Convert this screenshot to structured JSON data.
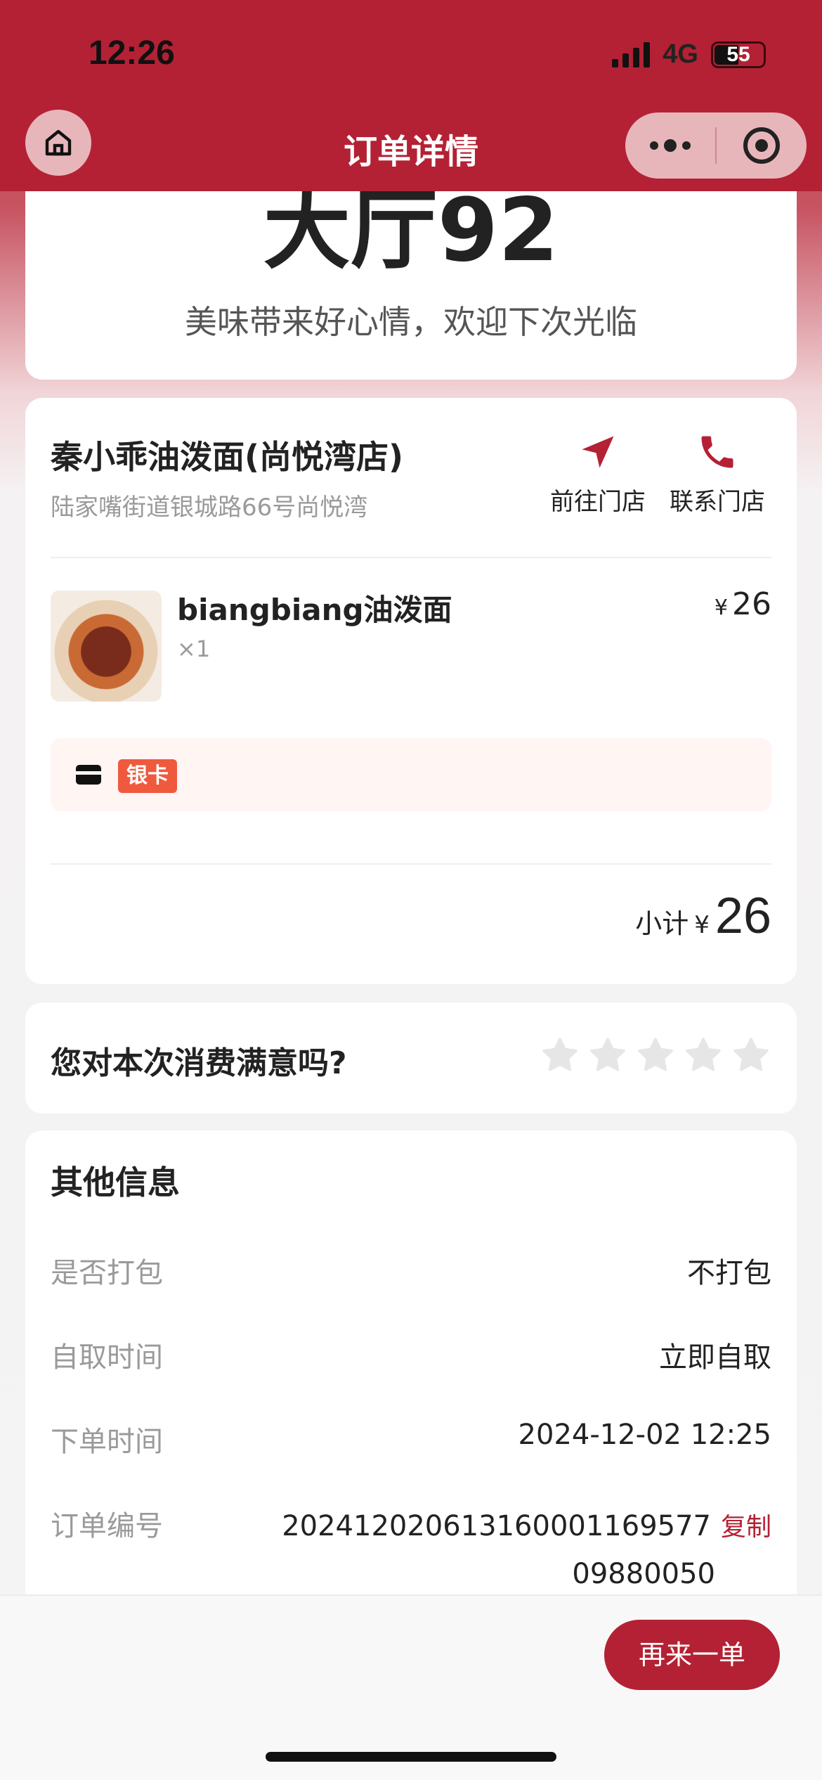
{
  "status_bar": {
    "time": "12:26",
    "network": "4G",
    "battery": "55"
  },
  "nav": {
    "title": "订单详情"
  },
  "pickup": {
    "code": "大厅92",
    "message": "美味带来好心情，欢迎下次光临"
  },
  "store": {
    "name": "秦小乖油泼面(尚悦湾店)",
    "address": "陆家嘴街道银城路66号尚悦湾",
    "go_label": "前往门店",
    "call_label": "联系门店"
  },
  "item": {
    "name": "biangbiang油泼面",
    "qty": "×1",
    "currency": "¥",
    "price": "26"
  },
  "payment": {
    "badge": "银卡"
  },
  "subtotal": {
    "label": "小计",
    "currency": "¥",
    "amount": "26"
  },
  "rating": {
    "question": "您对本次消费满意吗?",
    "max_stars": 5,
    "selected": 0
  },
  "info": {
    "title": "其他信息",
    "rows": [
      {
        "key": "是否打包",
        "value": "不打包"
      },
      {
        "key": "自取时间",
        "value": "立即自取"
      },
      {
        "key": "下单时间",
        "value": "2024-12-02 12:25"
      }
    ],
    "order_no_key": "订单编号",
    "order_no": "20241202061316000116957709880050",
    "copy_label": "复制"
  },
  "footer": {
    "reorder_label": "再来一单"
  },
  "colors": {
    "brand": "#b42134",
    "accent": "#ef5a3e",
    "badge_bg": "#fff5f3"
  },
  "icons": [
    "home-icon",
    "more-dots-icon",
    "target-icon",
    "navigate-arrow-icon",
    "phone-icon",
    "card-icon",
    "star-icon"
  ]
}
